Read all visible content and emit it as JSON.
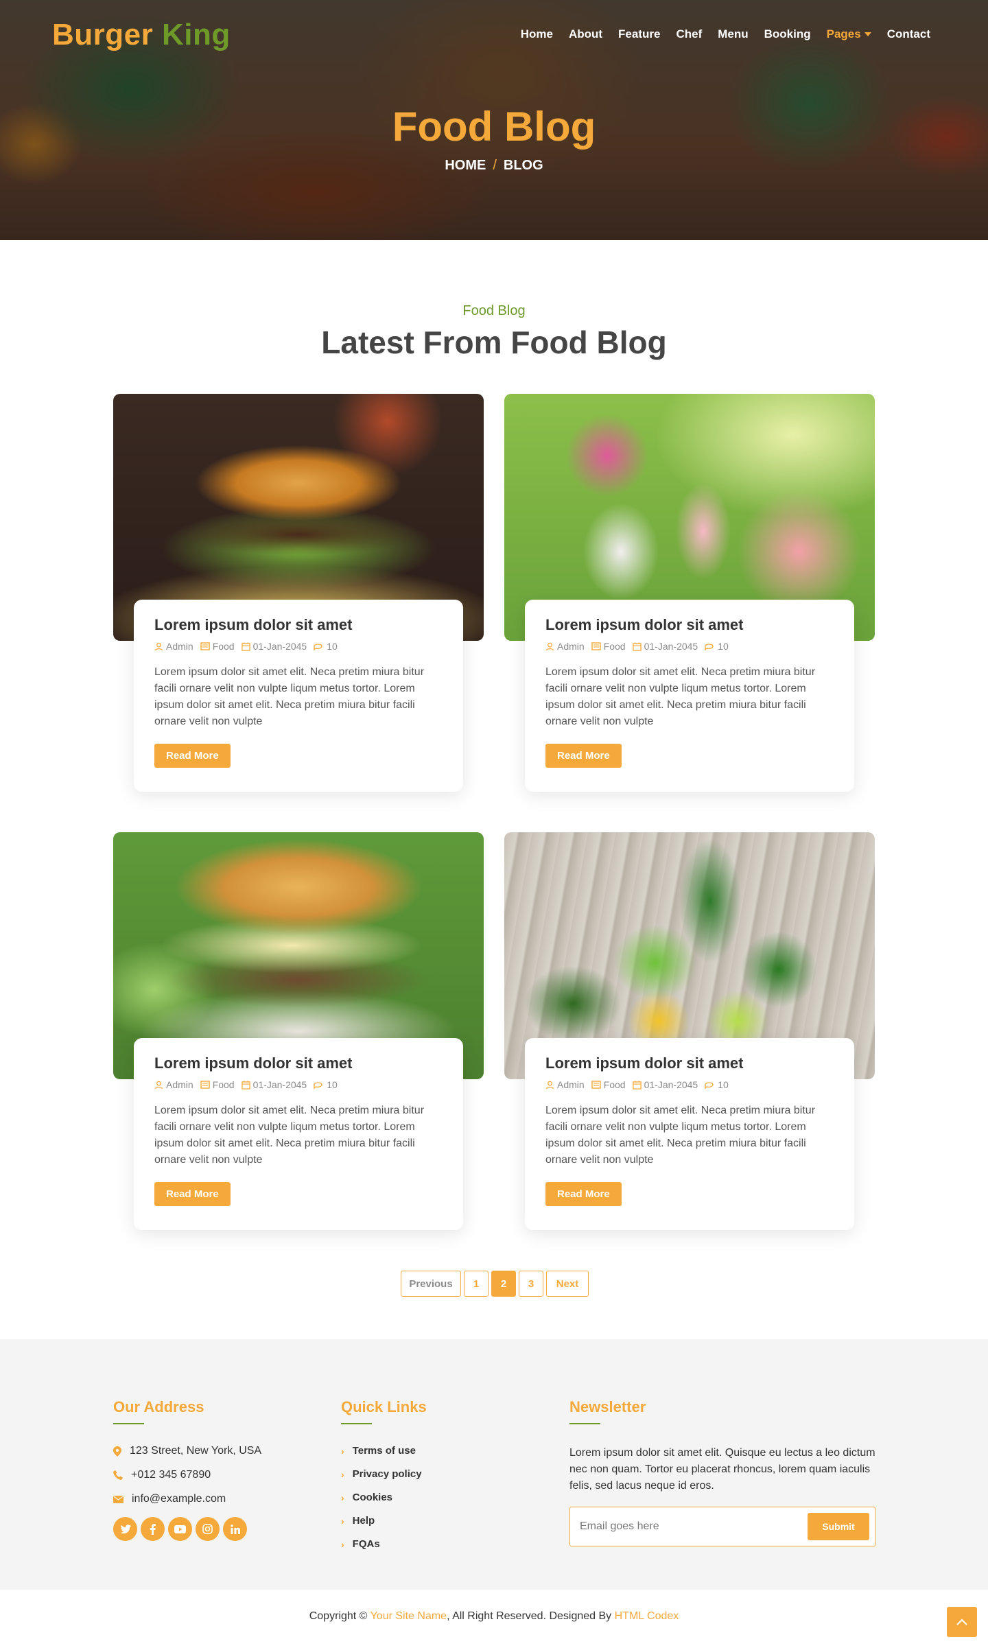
{
  "brand": {
    "part1": "Burger",
    "part2": "King"
  },
  "nav": {
    "items": [
      "Home",
      "About",
      "Feature",
      "Chef",
      "Menu",
      "Booking",
      "Pages",
      "Contact"
    ],
    "active": "Pages"
  },
  "hero": {
    "title": "Food Blog",
    "breadcrumb": [
      "HOME",
      "BLOG"
    ],
    "separator": "/"
  },
  "section": {
    "subtitle": "Food Blog",
    "title": "Latest From Food Blog"
  },
  "posts": [
    {
      "title": "Lorem ipsum dolor sit amet",
      "author": "Admin",
      "category": "Food",
      "date": "01-Jan-2045",
      "comments": "10",
      "excerpt": "Lorem ipsum dolor sit amet elit. Neca pretim miura bitur facili ornare velit non vulpte liqum metus tortor. Lorem ipsum dolor sit amet elit. Neca pretim miura bitur facili ornare velit non vulpte",
      "button": "Read More",
      "image_icon": "burger-photo"
    },
    {
      "title": "Lorem ipsum dolor sit amet",
      "author": "Admin",
      "category": "Food",
      "date": "01-Jan-2045",
      "comments": "10",
      "excerpt": "Lorem ipsum dolor sit amet elit. Neca pretim miura bitur facili ornare velit non vulpte liqum metus tortor. Lorem ipsum dolor sit amet elit. Neca pretim miura bitur facili ornare velit non vulpte",
      "button": "Read More",
      "image_icon": "lemonade-flowers-photo"
    },
    {
      "title": "Lorem ipsum dolor sit amet",
      "author": "Admin",
      "category": "Food",
      "date": "01-Jan-2045",
      "comments": "10",
      "excerpt": "Lorem ipsum dolor sit amet elit. Neca pretim miura bitur facili ornare velit non vulpte liqum metus tortor. Lorem ipsum dolor sit amet elit. Neca pretim miura bitur facili ornare velit non vulpte",
      "button": "Read More",
      "image_icon": "burger-salad-photo"
    },
    {
      "title": "Lorem ipsum dolor sit amet",
      "author": "Admin",
      "category": "Food",
      "date": "01-Jan-2045",
      "comments": "10",
      "excerpt": "Lorem ipsum dolor sit amet elit. Neca pretim miura bitur facili ornare velit non vulpte liqum metus tortor. Lorem ipsum dolor sit amet elit. Neca pretim miura bitur facili ornare velit non vulpte",
      "button": "Read More",
      "image_icon": "green-juice-fruits-photo"
    }
  ],
  "pagination": {
    "previous": "Previous",
    "pages": [
      "1",
      "2",
      "3"
    ],
    "current": "2",
    "next": "Next"
  },
  "footer": {
    "address": {
      "heading": "Our Address",
      "street": "123 Street, New York, USA",
      "phone": "+012 345 67890",
      "email": "info@example.com",
      "socials": [
        "twitter-icon",
        "facebook-icon",
        "youtube-icon",
        "instagram-icon",
        "linkedin-icon"
      ]
    },
    "quick_links": {
      "heading": "Quick Links",
      "items": [
        "Terms of use",
        "Privacy policy",
        "Cookies",
        "Help",
        "FQAs"
      ]
    },
    "newsletter": {
      "heading": "Newsletter",
      "text": "Lorem ipsum dolor sit amet elit. Quisque eu lectus a leo dictum nec non quam. Tortor eu placerat rhoncus, lorem quam iaculis felis, sed lacus neque id eros.",
      "placeholder": "Email goes here",
      "button": "Submit"
    }
  },
  "copyright": {
    "prefix": "Copyright © ",
    "site": "Your Site Name",
    "middle": ", All Right Reserved. Designed By ",
    "designer": "HTML Codex"
  },
  "colors": {
    "accent": "#f5a93a",
    "green": "#6e9a2a",
    "text": "#454545"
  }
}
